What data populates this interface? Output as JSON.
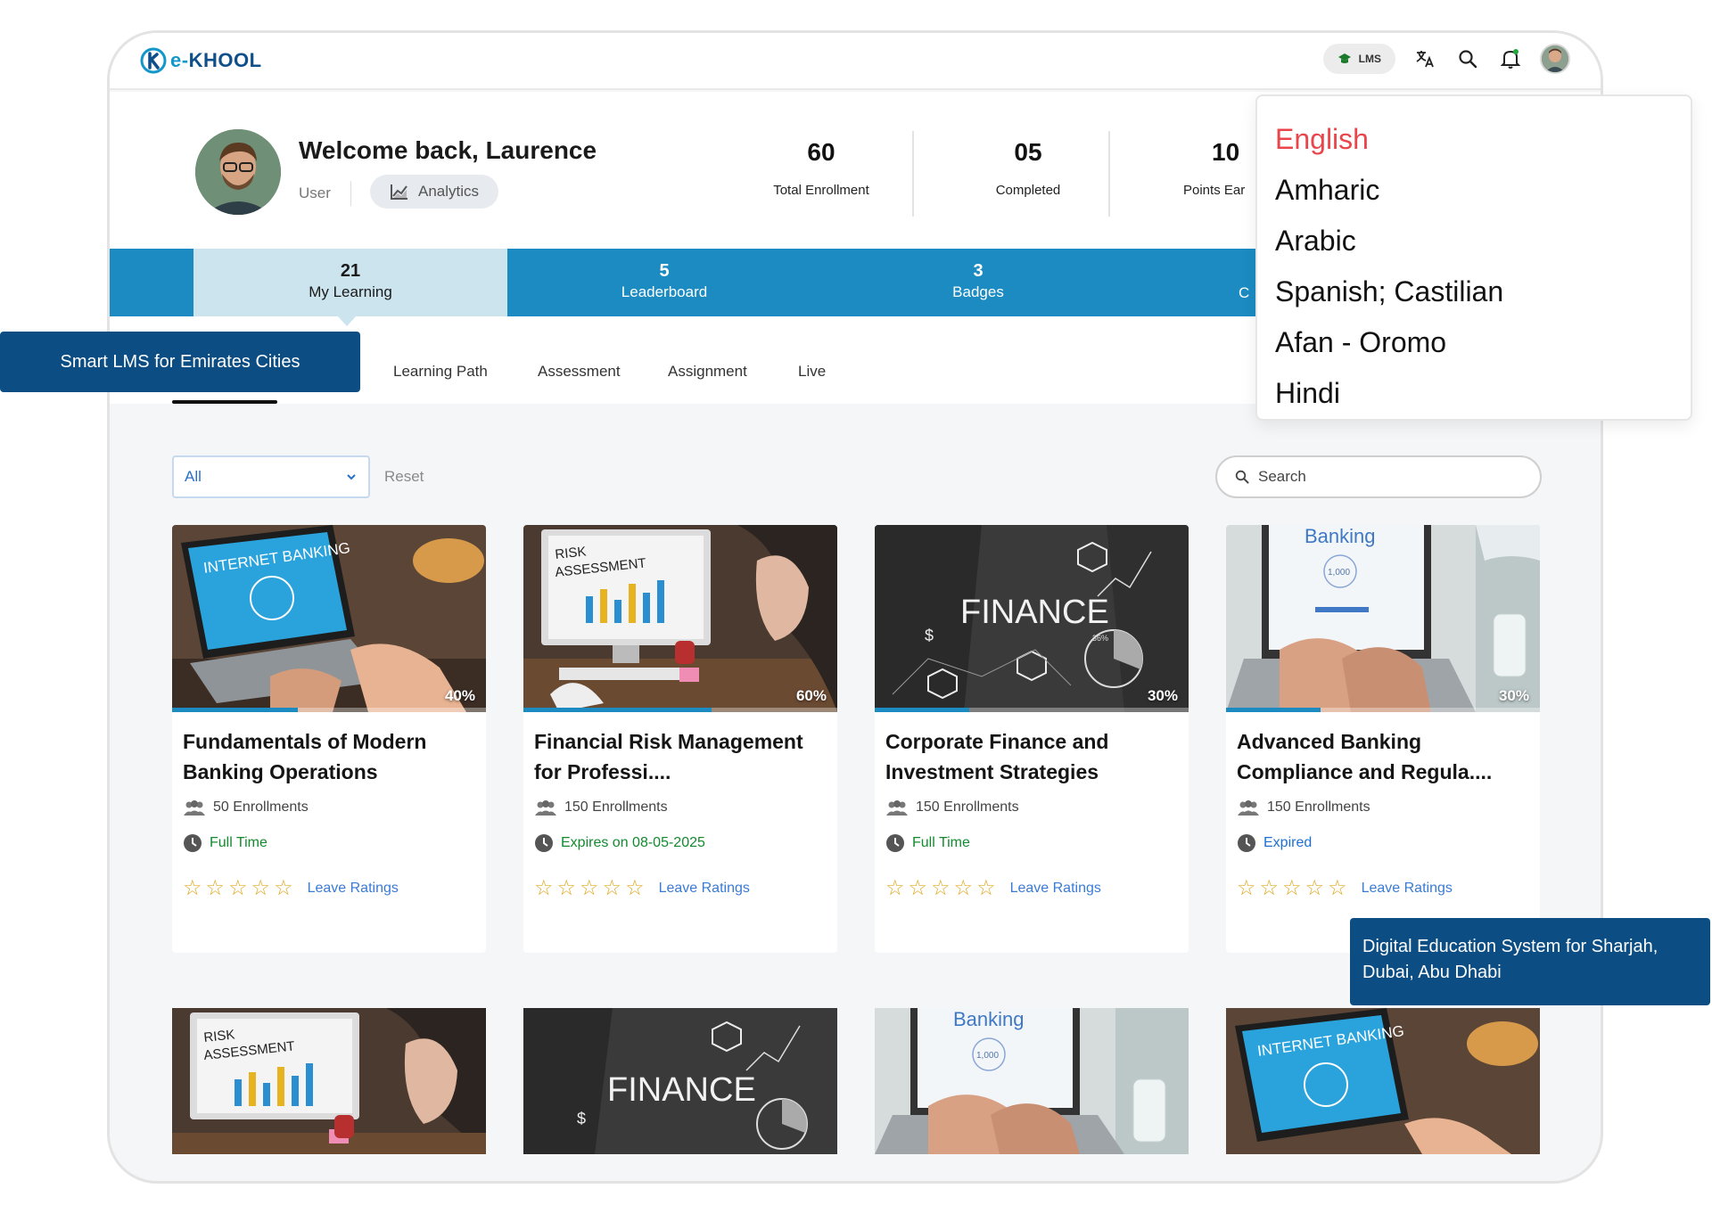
{
  "app": {
    "logo_text_e": "e-",
    "logo_text_rest": "KHOOL"
  },
  "topbar": {
    "lms_label": "LMS"
  },
  "profile": {
    "welcome": "Welcome back, Laurence",
    "role": "User",
    "analytics_label": "Analytics",
    "stats": [
      {
        "value": "60",
        "label": "Total Enrollment"
      },
      {
        "value": "05",
        "label": "Completed"
      },
      {
        "value": "10",
        "label": "Points Ear"
      }
    ]
  },
  "band_tabs": [
    {
      "count": "21",
      "label": "My Learning"
    },
    {
      "count": "5",
      "label": "Leaderboard"
    },
    {
      "count": "3",
      "label": "Badges"
    },
    {
      "count": "",
      "label": "C"
    }
  ],
  "sub_tabs": [
    "Learning Path",
    "Assessment",
    "Assignment",
    "Live"
  ],
  "filters": {
    "select_value": "All",
    "reset_label": "Reset",
    "search_placeholder": "Search"
  },
  "language_menu": {
    "items": [
      "English",
      "Amharic",
      "Arabic",
      "Spanish; Castilian",
      "Afan - Oromo",
      "Hindi"
    ],
    "selected": "English"
  },
  "courses": [
    {
      "title": "Fundamentals of Modern Banking Operations",
      "progress_pct": 40,
      "progress_label": "40%",
      "enrollments": "50 Enrollments",
      "status": "Full Time",
      "rating_label": "Leave Ratings",
      "thumb": "internet-banking"
    },
    {
      "title": "Financial Risk Management for Professi....",
      "progress_pct": 60,
      "progress_label": "60%",
      "enrollments": "150 Enrollments",
      "status": "Expires on 08-05-2025",
      "rating_label": "Leave Ratings",
      "thumb": "risk-assessment"
    },
    {
      "title": "Corporate Finance and Investment Strategies",
      "progress_pct": 30,
      "progress_label": "30%",
      "enrollments": "150 Enrollments",
      "status": "Full Time",
      "rating_label": "Leave Ratings",
      "thumb": "finance"
    },
    {
      "title": "Advanced Banking Compliance and Regula....",
      "progress_pct": 30,
      "progress_label": "30%",
      "enrollments": "150 Enrollments",
      "status": "Expired",
      "rating_label": "Leave Ratings",
      "thumb": "banking"
    }
  ],
  "thumb_text": {
    "internet_banking": "INTERNET BANKING",
    "risk": "RISK",
    "assessment": "ASSESSMENT",
    "finance": "FINANCE",
    "banking": "Banking",
    "amount": "1,000",
    "percent_small": "36%"
  },
  "callouts": {
    "left": "Smart LMS for Emirates Cities",
    "right": "Digital Education System for Sharjah, Dubai, Abu Dhabi"
  },
  "colors": {
    "brand_blue": "#1b8bc2",
    "navy": "#0c4d83",
    "status_green": "#138a2e",
    "link_blue": "#3a7bd5",
    "star": "#e0a81f",
    "selected_red": "#e8464b"
  }
}
